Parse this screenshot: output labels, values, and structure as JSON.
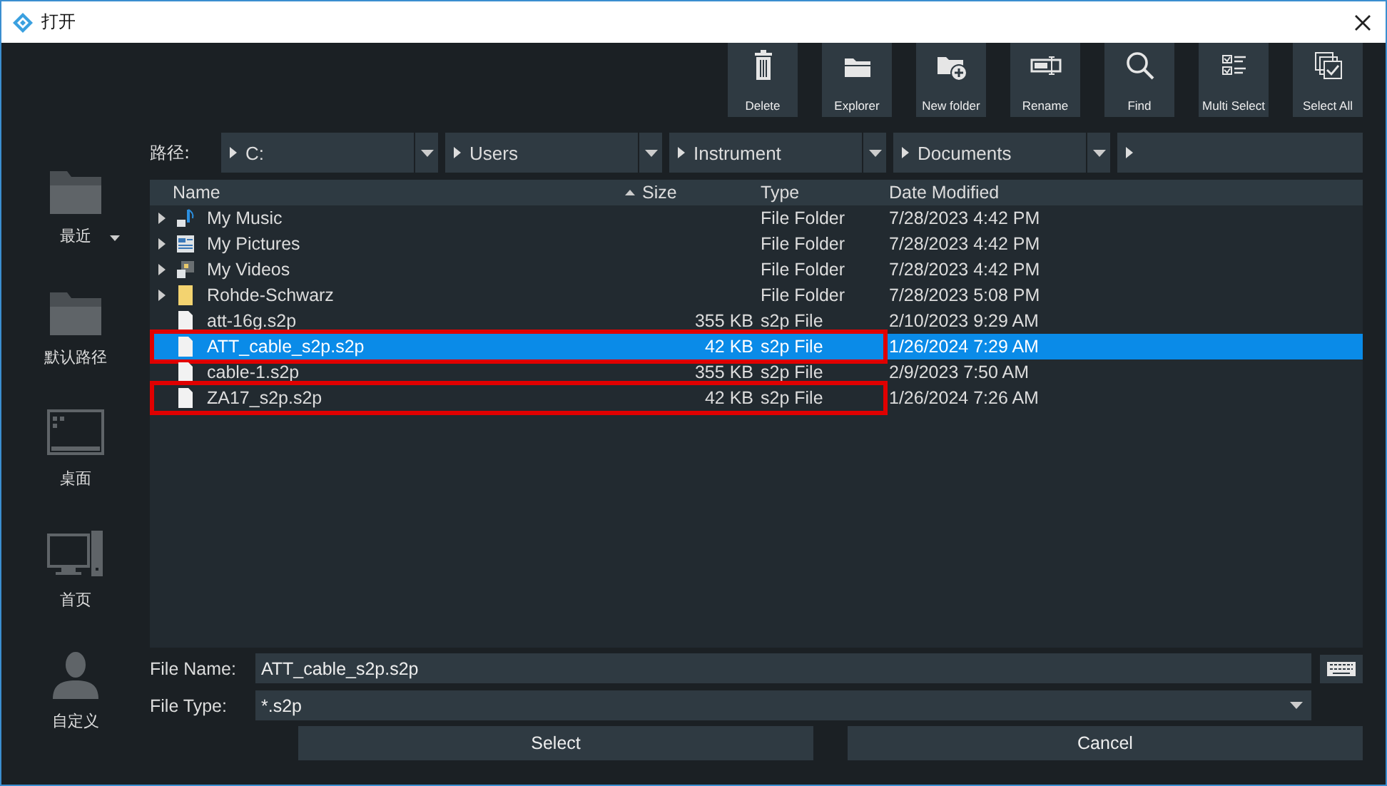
{
  "window": {
    "title": "打开"
  },
  "toolbar": [
    {
      "label": "Delete",
      "kind": "trash"
    },
    {
      "label": "Explorer",
      "kind": "folder"
    },
    {
      "label": "New folder",
      "kind": "new-folder"
    },
    {
      "label": "Rename",
      "kind": "rename"
    },
    {
      "label": "Find",
      "kind": "search"
    },
    {
      "label": "Multi Select",
      "kind": "checklist"
    },
    {
      "label": "Select All",
      "kind": "select-all"
    }
  ],
  "sidebar": {
    "items": [
      {
        "label": "最近",
        "kind": "folder",
        "dropdown": true
      },
      {
        "label": "默认路径",
        "kind": "folder",
        "dropdown": false
      },
      {
        "label": "桌面",
        "kind": "desktop",
        "dropdown": false
      },
      {
        "label": "首页",
        "kind": "computer",
        "dropdown": false
      },
      {
        "label": "自定义",
        "kind": "person",
        "dropdown": false
      }
    ]
  },
  "path": {
    "label": "路径:",
    "segments": [
      {
        "name": "C:",
        "dropdown": true
      },
      {
        "name": "Users",
        "dropdown": true
      },
      {
        "name": "Instrument",
        "dropdown": true
      },
      {
        "name": "Documents",
        "dropdown": true
      },
      {
        "dropdown": false
      }
    ]
  },
  "table": {
    "columns": [
      {
        "label": "Name",
        "sorted": false
      },
      {
        "label": "Size",
        "sorted": true
      },
      {
        "label": "Type",
        "sorted": false
      },
      {
        "label": "Date Modified",
        "sorted": false
      }
    ],
    "rows": [
      {
        "kind": "music",
        "name": "My Music",
        "size": "",
        "type": "File Folder",
        "date": "7/28/2023 4:42 PM",
        "selected": false,
        "annotated": false
      },
      {
        "kind": "pictures",
        "name": "My Pictures",
        "size": "",
        "type": "File Folder",
        "date": "7/28/2023 4:42 PM",
        "selected": false,
        "annotated": false
      },
      {
        "kind": "videos",
        "name": "My Videos",
        "size": "",
        "type": "File Folder",
        "date": "7/28/2023 4:42 PM",
        "selected": false,
        "annotated": false
      },
      {
        "kind": "folder",
        "name": "Rohde-Schwarz",
        "size": "",
        "type": "File Folder",
        "date": "7/28/2023 5:08 PM",
        "selected": false,
        "annotated": false
      },
      {
        "kind": "file",
        "name": "att-16g.s2p",
        "size": "355 KB",
        "type": "s2p File",
        "date": "2/10/2023 9:29 AM",
        "selected": false,
        "annotated": false
      },
      {
        "kind": "file",
        "name": "ATT_cable_s2p.s2p",
        "size": "42 KB",
        "type": "s2p File",
        "date": "1/26/2024 7:29 AM",
        "selected": true,
        "annotated": true
      },
      {
        "kind": "file",
        "name": "cable-1.s2p",
        "size": "355 KB",
        "type": "s2p File",
        "date": "2/9/2023 7:50 AM",
        "selected": false,
        "annotated": false
      },
      {
        "kind": "file",
        "name": "ZA17_s2p.s2p",
        "size": "42 KB",
        "type": "s2p File",
        "date": "1/26/2024 7:26 AM",
        "selected": false,
        "annotated": true
      }
    ]
  },
  "file_name": {
    "label": "File Name:",
    "value": "ATT_cable_s2p.s2p"
  },
  "file_type": {
    "label": "File Type:",
    "value": "*.s2p"
  },
  "buttons": [
    "Select",
    "Cancel"
  ]
}
